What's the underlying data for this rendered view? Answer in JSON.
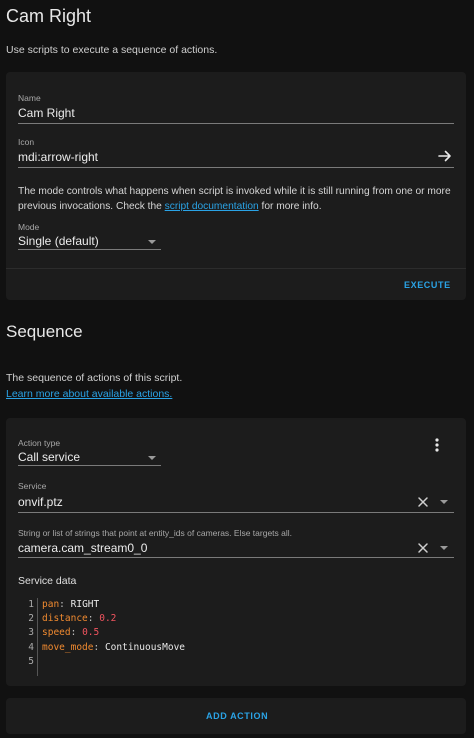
{
  "page": {
    "title": "Cam Right",
    "description": "Use scripts to execute a sequence of actions."
  },
  "script_card": {
    "name_label": "Name",
    "name_value": "Cam Right",
    "icon_label": "Icon",
    "icon_value": "mdi:arrow-right",
    "icon_preview": "arrow-right-icon",
    "mode_help_before": "The mode controls what happens when script is invoked while it is still running from one or more previous invocations. Check the ",
    "mode_help_link": "script documentation",
    "mode_help_after": " for more info.",
    "mode_label": "Mode",
    "mode_value": "Single (default)",
    "execute_label": "EXECUTE"
  },
  "sequence": {
    "title": "Sequence",
    "description": "The sequence of actions of this script.",
    "learn_more": "Learn more about available actions."
  },
  "action_card": {
    "action_type_label": "Action type",
    "action_type_value": "Call service",
    "menu_icon": "more-vertical-icon",
    "service_label": "Service",
    "service_value": "onvif.ptz",
    "target_label": "String or list of strings that point at entity_ids of cameras. Else targets all.",
    "target_value": "camera.cam_stream0_0",
    "service_data_label": "Service data",
    "code_lines": [
      {
        "num": "1",
        "key": "pan",
        "sep": ": ",
        "val": "RIGHT",
        "val_type": "string"
      },
      {
        "num": "2",
        "key": "distance",
        "sep": ": ",
        "val": "0.2",
        "val_type": "number"
      },
      {
        "num": "3",
        "key": "speed",
        "sep": ": ",
        "val": "0.5",
        "val_type": "number"
      },
      {
        "num": "4",
        "key": "move_mode",
        "sep": ": ",
        "val": "ContinuousMove",
        "val_type": "string"
      },
      {
        "num": "5",
        "key": "",
        "sep": "",
        "val": "",
        "val_type": "string"
      }
    ]
  },
  "add_action_label": "ADD ACTION",
  "colors": {
    "background": "#111111",
    "card": "#1c1c1c",
    "accent": "#2aa3e6",
    "yaml_key": "#f08a30",
    "yaml_number": "#f0545f"
  }
}
